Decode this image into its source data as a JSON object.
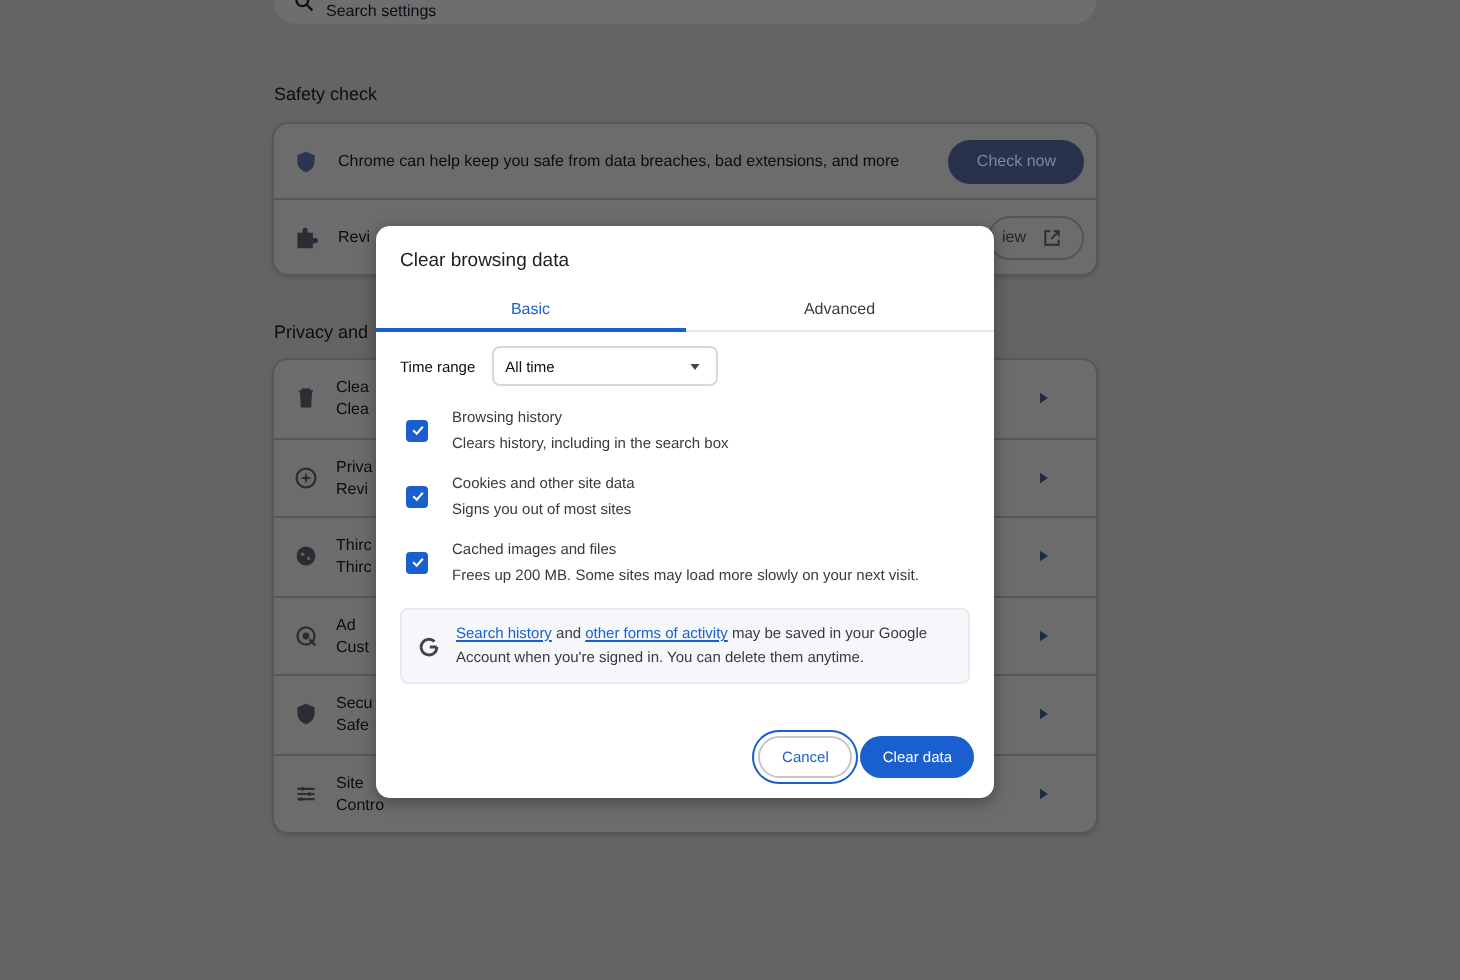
{
  "search": {
    "placeholder": "Search settings"
  },
  "safety_check": {
    "heading": "Safety check",
    "rows": [
      {
        "text": "Chrome can help keep you safe from data breaches, bad extensions, and more",
        "button": "Check now",
        "kind": "check"
      },
      {
        "text": "Revi",
        "button": "iew",
        "kind": "review"
      }
    ]
  },
  "privacy": {
    "heading": "Privacy and",
    "rows": [
      {
        "title": "Clea",
        "subtitle": "Clea"
      },
      {
        "title": "Priva",
        "subtitle": "Revi"
      },
      {
        "title": "Thirc",
        "subtitle": "Thirc"
      },
      {
        "title": "Ad",
        "subtitle": "Cust"
      },
      {
        "title": "Secu",
        "subtitle": "Safe"
      },
      {
        "title": "Site",
        "subtitle": "Contro"
      }
    ]
  },
  "dialog": {
    "title": "Clear browsing data",
    "tabs": [
      {
        "label": "Basic",
        "selected": true
      },
      {
        "label": "Advanced",
        "selected": false
      }
    ],
    "time_range": {
      "label": "Time range",
      "value": "All time"
    },
    "options": [
      {
        "title": "Browsing history",
        "description": "Clears history, including in the search box",
        "checked": true
      },
      {
        "title": "Cookies and other site data",
        "description": "Signs you out of most sites",
        "checked": true
      },
      {
        "title": "Cached images and files",
        "description": "Frees up 200 MB. Some sites may load more slowly on your next visit.",
        "checked": true
      }
    ],
    "info": {
      "segments": [
        {
          "text": "Search history",
          "link": true
        },
        {
          "text": " and ",
          "link": false
        },
        {
          "text": "other forms of activity",
          "link": true
        },
        {
          "text": " may be saved in your Google Account when you're signed in. You can delete them anytime.",
          "link": false
        }
      ]
    },
    "buttons": [
      {
        "label": "Cancel",
        "kind": "secondary",
        "focused": true
      },
      {
        "label": "Clear data",
        "kind": "primary",
        "focused": false
      }
    ]
  }
}
